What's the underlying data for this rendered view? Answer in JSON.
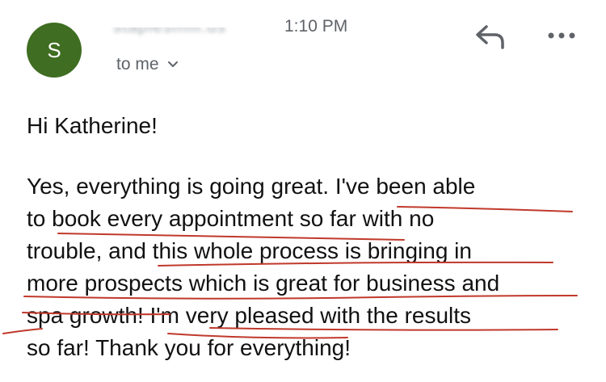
{
  "header": {
    "avatar_letter": "S",
    "avatar_color": "#3f6d21",
    "sender": "staplesmill.us",
    "time": "1:10 PM",
    "recipient_label": "to me",
    "recipient_chevron_icon": "chevron-down-icon",
    "reply_icon": "reply-icon",
    "more_icon": "more-horizontal-icon"
  },
  "message": {
    "greeting": "Hi Katherine!",
    "body_lines": [
      "Yes, everything is going great. I've been able",
      "to book every appointment so far with no",
      "trouble, and this whole process is bringing in",
      "more prospects which is great for business and",
      "spa growth! I'm very pleased with the results",
      "so far! Thank you for everything!"
    ]
  },
  "annotation_color": "#c0392b"
}
